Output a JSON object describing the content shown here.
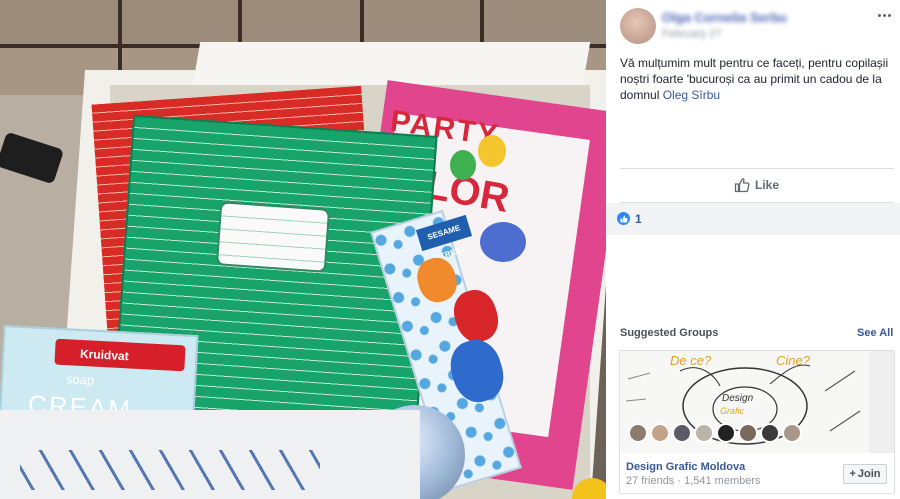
{
  "post": {
    "author_name": "Olga Cornelia Serbu",
    "timestamp": "February 27",
    "text_before_link": "Vă mulțumim mult pentru ce faceți, pentru copilașii noștri foarte 'bucuroși ca au primit un cadou de la domnul ",
    "link_text": "Oleg Sîrbu",
    "like_button_label": "Like",
    "like_count": "1"
  },
  "photo": {
    "soap_brand": "Kruidvat",
    "soap_word": "soap",
    "cream_word": "CREAM",
    "book_title_top": "PARTY",
    "book_title_bottom": "LOR",
    "sesame_badge": "SESAME STREET"
  },
  "suggested_groups": {
    "title": "Suggested Groups",
    "see_all_label": "See All",
    "group": {
      "name": "Design Grafic Moldova",
      "meta": "27 friends · 1,541 members",
      "join_label": "Join",
      "cover_text_1": "De ce?",
      "cover_text_2": "Cine?",
      "cover_text_3": "Design",
      "cover_text_4": "Grafic"
    }
  },
  "colors": {
    "link": "#385898",
    "like_blue": "#2d88ff",
    "text": "#1d2129",
    "meta": "#90949c"
  },
  "icons": [
    "more-options-icon",
    "like-thumb-icon",
    "like-reaction-icon",
    "plus-icon"
  ]
}
